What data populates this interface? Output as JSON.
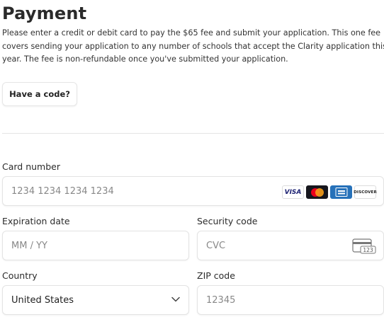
{
  "page": {
    "title": "Payment",
    "description_lines": [
      "Please enter a credit or debit card to pay the $65 fee and submit your application. This one fee",
      "covers sending your application to any number of schools that accept the Clarity application this",
      "year. The fee is non-refundable once you've submitted your application."
    ]
  },
  "code_button": {
    "label": "Have a code?"
  },
  "card_number": {
    "label": "Card number",
    "placeholder": "1234 1234 1234 1234",
    "value": "",
    "brands": [
      "VISA",
      "mastercard",
      "amex",
      "DISCOVER"
    ]
  },
  "expiration": {
    "label": "Expiration date",
    "placeholder": "MM / YY",
    "value": ""
  },
  "security_code": {
    "label": "Security code",
    "placeholder": "CVC",
    "value": "",
    "icon_text": "123"
  },
  "country": {
    "label": "Country",
    "value": "United States"
  },
  "zip": {
    "label": "ZIP code",
    "placeholder": "12345",
    "value": ""
  },
  "colors": {
    "visa_blue": "#1a1f71",
    "mastercard_red": "#eb001b",
    "mastercard_orange": "#f79e1b",
    "amex_blue": "#2671b9",
    "discover_orange": "#f58220"
  }
}
